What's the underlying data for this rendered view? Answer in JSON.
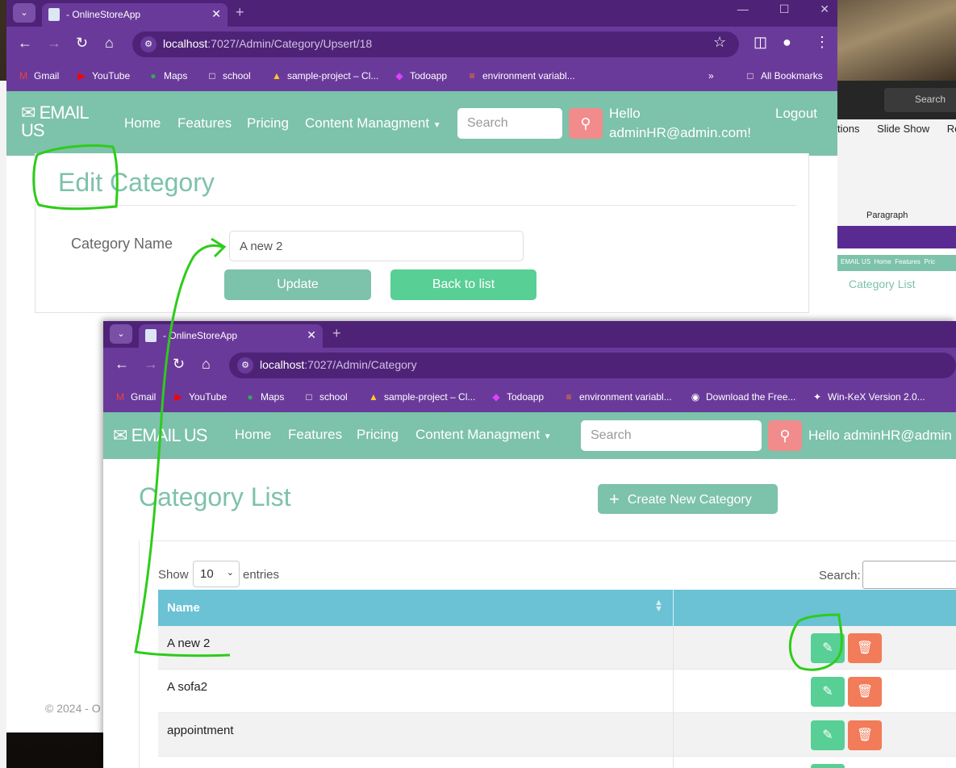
{
  "colors": {
    "tab_purple": "#4e2377",
    "toolbar_purple": "#6a3a9a",
    "navbar_green": "#7dc2aa",
    "search_red": "#f28b8b",
    "table_header": "#6ac2d4",
    "edit_green": "#58cf95",
    "delete_orange": "#f27b59",
    "annotation_green": "#2ecc1a"
  },
  "word_app": {
    "search_label": "Search",
    "tabs": [
      "tions",
      "Slide Show",
      "Re"
    ],
    "group_label": "Paragraph",
    "thumb_logo": "EMAIL US",
    "thumb_nav": [
      "Home",
      "Features",
      "Pric"
    ],
    "thumb_title": "Category List"
  },
  "window_back": {
    "tab_title": "- OnlineStoreApp",
    "url_host": "localhost",
    "url_path": ":7027/Admin/Category/Upsert/18",
    "bookmarks": [
      {
        "icon": "gmail-icon",
        "label": "Gmail"
      },
      {
        "icon": "youtube-icon",
        "label": "YouTube"
      },
      {
        "icon": "maps-icon",
        "label": "Maps"
      },
      {
        "icon": "folder-icon",
        "label": "school"
      },
      {
        "icon": "firebase-icon",
        "label": "sample-project – Cl..."
      },
      {
        "icon": "todoapp-icon",
        "label": "Todoapp"
      },
      {
        "icon": "stack-icon",
        "label": "environment variabl..."
      }
    ],
    "all_bookmarks": "All Bookmarks",
    "site": {
      "logo": "EMAIL US",
      "nav": [
        "Home",
        "Features",
        "Pricing",
        "Content Managment"
      ],
      "search_placeholder": "Search",
      "hello": "Hello adminHR@admin.com!",
      "logout": "Logout"
    },
    "page": {
      "title": "Edit Category",
      "field_label": "Category Name",
      "field_value": "A new 2",
      "update_label": "Update",
      "back_label": "Back to list",
      "footer": "© 2024 - O"
    }
  },
  "window_front": {
    "tab_title": "- OnlineStoreApp",
    "url_host": "localhost",
    "url_path": ":7027/Admin/Category",
    "bookmarks": [
      {
        "icon": "gmail-icon",
        "label": "Gmail"
      },
      {
        "icon": "youtube-icon",
        "label": "YouTube"
      },
      {
        "icon": "maps-icon",
        "label": "Maps"
      },
      {
        "icon": "folder-icon",
        "label": "school"
      },
      {
        "icon": "firebase-icon",
        "label": "sample-project – Cl..."
      },
      {
        "icon": "todoapp-icon",
        "label": "Todoapp"
      },
      {
        "icon": "stack-icon",
        "label": "environment variabl..."
      },
      {
        "icon": "eye-icon",
        "label": "Download the Free..."
      },
      {
        "icon": "kex-icon",
        "label": "Win-KeX Version 2.0..."
      }
    ],
    "site": {
      "logo": "EMAIL US",
      "nav": [
        "Home",
        "Features",
        "Pricing",
        "Content Managment"
      ],
      "search_placeholder": "Search",
      "hello": "Hello adminHR@admin"
    },
    "page": {
      "title": "Category List",
      "create_label": "Create New Category",
      "show_label": "Show",
      "page_size": "10",
      "entries_label": "entries",
      "search_label": "Search:",
      "column_name": "Name",
      "rows": [
        "A new 2",
        "A sofa2",
        "appointment",
        ""
      ]
    }
  }
}
